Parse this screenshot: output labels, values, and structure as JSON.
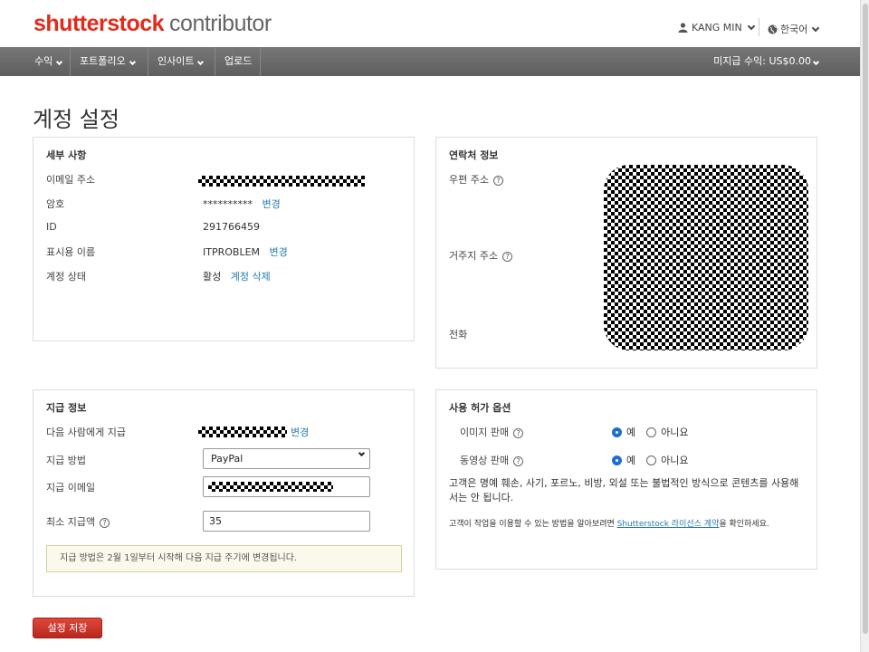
{
  "header": {
    "logo_brand": "shutterstock",
    "logo_sub": "contributor",
    "user_name": "KANG MIN",
    "language": "한국어"
  },
  "nav": {
    "items": [
      "수익",
      "포트폴리오",
      "인사이트",
      "업로드"
    ],
    "balance": "미지급 수익: US$0.00"
  },
  "page": {
    "title": "계정 설정"
  },
  "details": {
    "title": "세부 사항",
    "email_label": "이메일 주소",
    "password_label": "암호",
    "password_value": "**********",
    "password_change": "변경",
    "id_label": "ID",
    "id_value": "291766459",
    "display_name_label": "표시용 이름",
    "display_name_value": "ITPROBLEM",
    "display_name_change": "변경",
    "status_label": "계정 상태",
    "status_value": "활성",
    "delete_account": "계정 삭제"
  },
  "contact": {
    "title": "연락처 정보",
    "postal_label": "우편 주소",
    "residence_label": "거주지 주소",
    "phone_label": "전화"
  },
  "payment": {
    "title": "지급 정보",
    "payee_label": "다음 사람에게 지급",
    "payee_change": "변경",
    "method_label": "지급 방법",
    "method_value": "PayPal",
    "email_label": "지급 이메일",
    "min_label": "최소 지급액",
    "min_value": "35",
    "notice": "지급 방법은 2월 1일부터 시작해 다음 지급 주기에 변경됩니다."
  },
  "licensing": {
    "title": "사용 허가 옵션",
    "image_label": "이미지 판매",
    "video_label": "동영상 판매",
    "yes": "예",
    "no": "아니요",
    "image_selected": "yes",
    "video_selected": "yes",
    "warning": "고객은 명예 훼손, 사기, 포르노, 비방, 외설 또는 불법적인 방식으로 콘텐츠를 사용해서는 안 됩니다.",
    "license_prefix": "고객이 작업을 이용할 수 있는 방법을 알아보려면 ",
    "license_link": "Shutterstock 라이선스 계약",
    "license_suffix": "을 확인하세요."
  },
  "actions": {
    "save": "설정 저장"
  },
  "colors": {
    "brand_red": "#e22b1a",
    "link": "#2a7ab0",
    "nav_bg": "#666666",
    "radio_on": "#1a6fd4"
  }
}
